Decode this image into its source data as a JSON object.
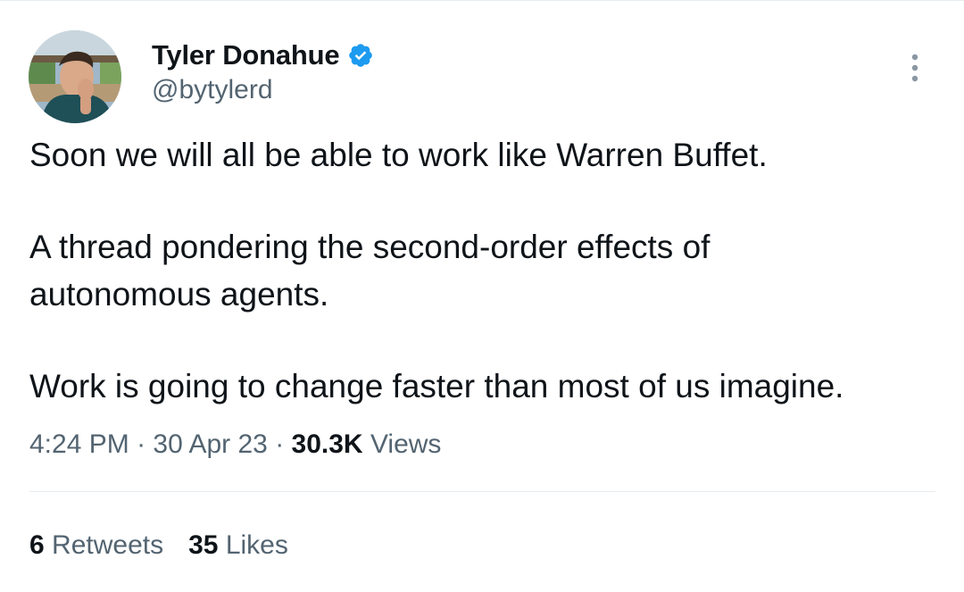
{
  "author": {
    "display_name": "Tyler Donahue",
    "handle": "@bytylerd",
    "verified": true
  },
  "tweet": {
    "paragraphs": [
      "Soon we will all be able to work like Warren Buffet.",
      "A thread pondering the second-order effects of",
      "autonomous agents.",
      "Work is going to change faster than most of us imagine."
    ],
    "time": "4:24 PM",
    "separator": "·",
    "date": "30 Apr 23",
    "views_count": "30.3K",
    "views_label": "Views"
  },
  "stats": {
    "retweets_count": "6",
    "retweets_label": "Retweets",
    "likes_count": "35",
    "likes_label": "Likes"
  },
  "colors": {
    "primary_text": "#0f1419",
    "secondary_text": "#536471",
    "verified_blue": "#1d9bf0",
    "divider": "#e6ecf0"
  },
  "icons": {
    "verified": "verified-badge-icon",
    "more": "more-options-icon"
  }
}
